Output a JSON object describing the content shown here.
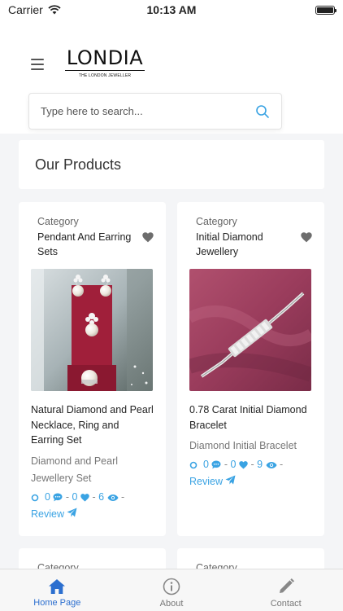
{
  "status_bar": {
    "carrier": "Carrier",
    "time": "10:13 AM"
  },
  "header": {
    "logo_text": "LONDIA",
    "logo_tagline": "THE LONDON JEWELLER"
  },
  "search": {
    "placeholder": "Type here to search..."
  },
  "section": {
    "title": "Our Products"
  },
  "products": [
    {
      "category_label": "Category",
      "category_name": "Pendant And Earring Sets",
      "title": "Natural Diamond and Pearl Necklace, Ring and Earring Set",
      "subtitle": "Diamond and Pearl Jewellery Set",
      "comments": "0",
      "likes": "0",
      "views": "6",
      "review_label": "Review"
    },
    {
      "category_label": "Category",
      "category_name": "Initial Diamond Jewellery",
      "title": "0.78 Carat Initial Diamond Bracelet",
      "subtitle": "Diamond Initial Bracelet",
      "comments": "0",
      "likes": "0",
      "views": "9",
      "review_label": "Review"
    },
    {
      "category_label": "Category"
    },
    {
      "category_label": "Category"
    }
  ],
  "tab_bar": {
    "items": [
      {
        "label": "Home Page",
        "icon": "home-icon",
        "active": true
      },
      {
        "label": "About",
        "icon": "info-icon",
        "active": false
      },
      {
        "label": "Contact",
        "icon": "pencil-icon",
        "active": false
      }
    ]
  },
  "colors": {
    "accent": "#3aa3e3",
    "active_tab": "#2c6fcf",
    "background": "#f4f5f7"
  }
}
